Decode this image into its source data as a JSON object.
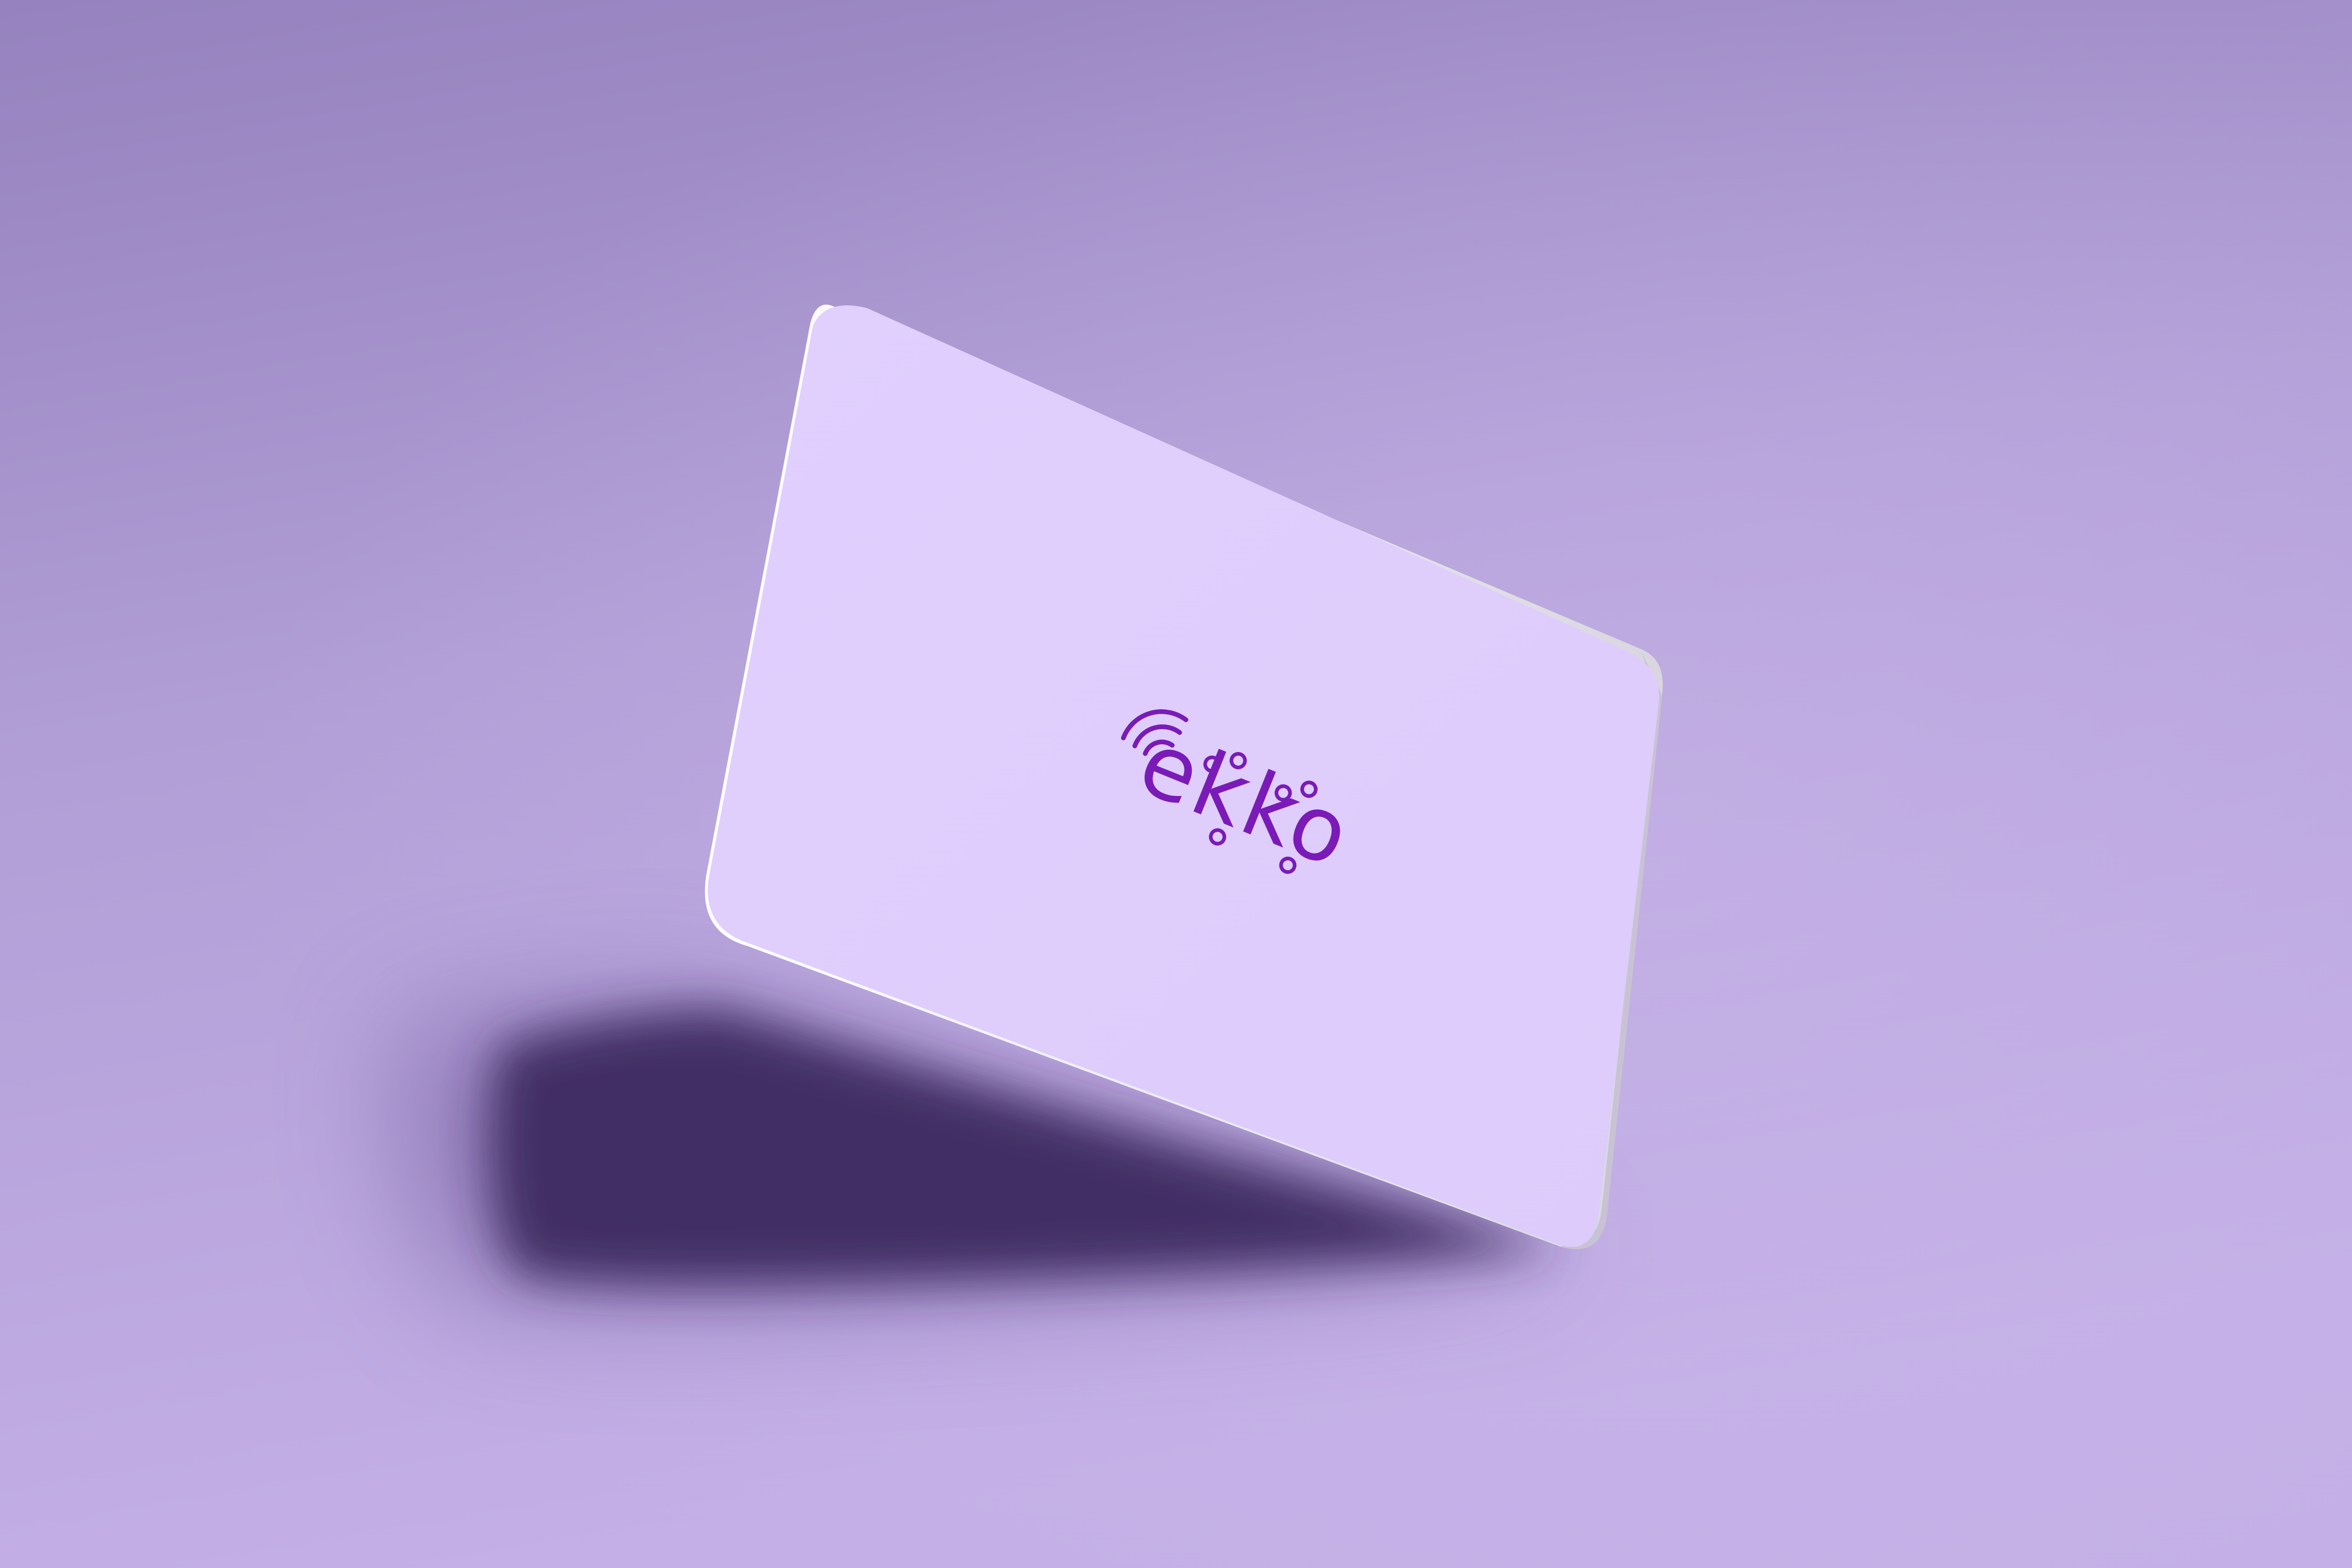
{
  "scene": {
    "description_free": true,
    "background_top_color": "#9582be",
    "background_bottom_color": "#c4b0e6",
    "shadow_color": "#3e2961"
  },
  "card": {
    "face_color": "#dfcdfd",
    "edge_color": "#f2f0f6",
    "edge_shade_color": "#b9b3c8"
  },
  "logo": {
    "wordmark": "ekko",
    "color": "#7a1bb8",
    "icon": "nfc-wave-icon"
  }
}
